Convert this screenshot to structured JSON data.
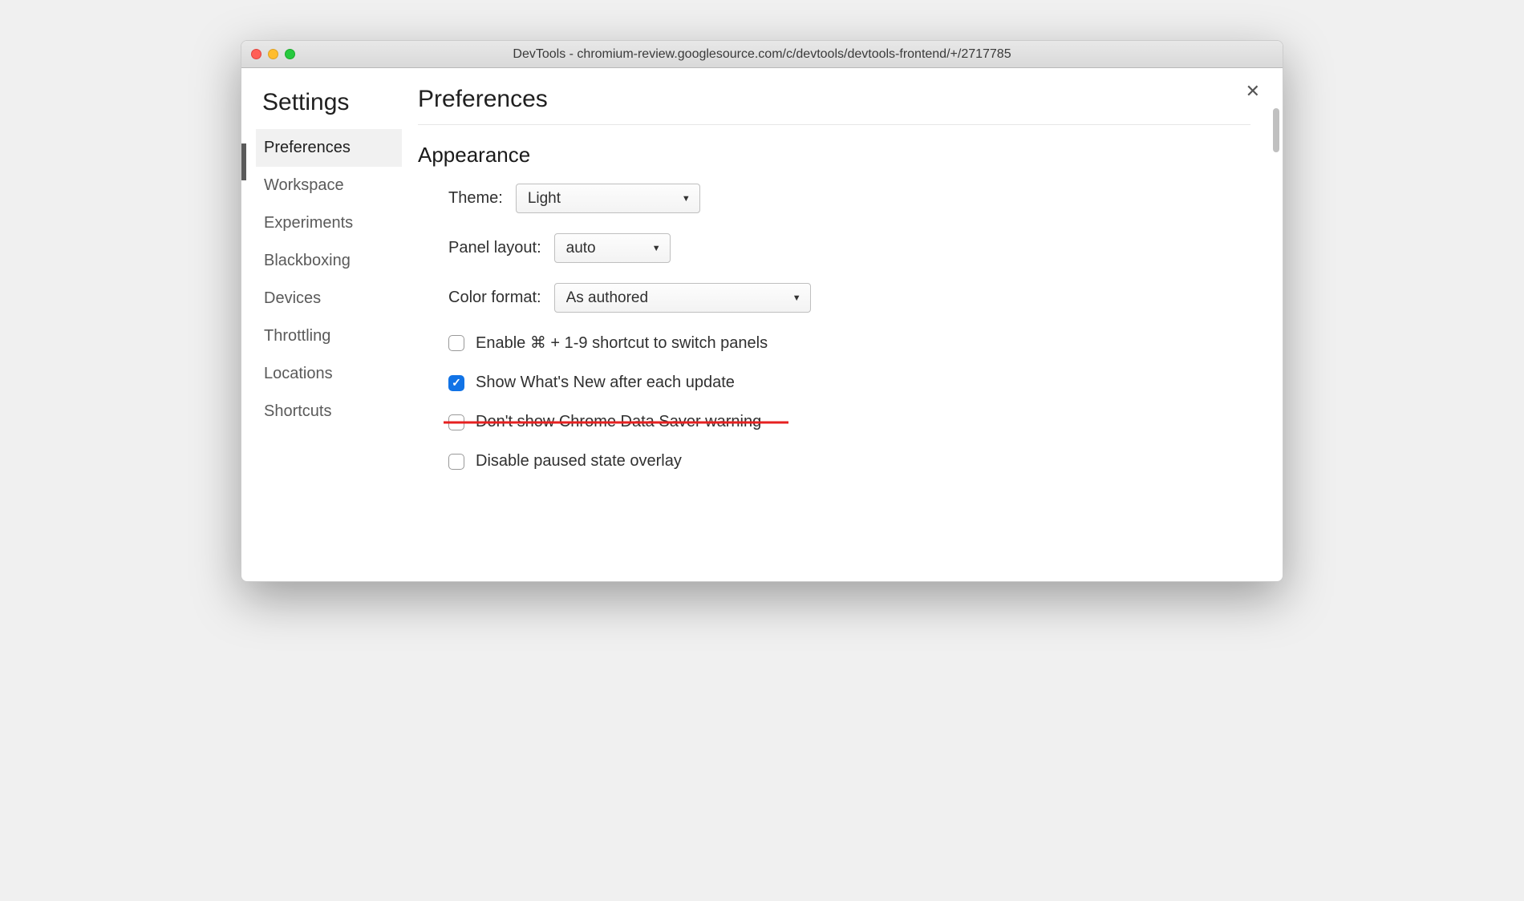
{
  "window": {
    "title": "DevTools - chromium-review.googlesource.com/c/devtools/devtools-frontend/+/2717785"
  },
  "sidebar": {
    "title": "Settings",
    "items": [
      {
        "label": "Preferences",
        "active": true
      },
      {
        "label": "Workspace",
        "active": false
      },
      {
        "label": "Experiments",
        "active": false
      },
      {
        "label": "Blackboxing",
        "active": false
      },
      {
        "label": "Devices",
        "active": false
      },
      {
        "label": "Throttling",
        "active": false
      },
      {
        "label": "Locations",
        "active": false
      },
      {
        "label": "Shortcuts",
        "active": false
      }
    ]
  },
  "main": {
    "title": "Preferences",
    "section_appearance": "Appearance",
    "theme_label": "Theme:",
    "theme_value": "Light",
    "panel_layout_label": "Panel layout:",
    "panel_layout_value": "auto",
    "color_format_label": "Color format:",
    "color_format_value": "As authored",
    "checkbox_shortcut": "Enable ⌘ + 1-9 shortcut to switch panels",
    "checkbox_whatsnew": "Show What's New after each update",
    "checkbox_datasaver": "Don't show Chrome Data Saver warning",
    "checkbox_paused": "Disable paused state overlay"
  }
}
